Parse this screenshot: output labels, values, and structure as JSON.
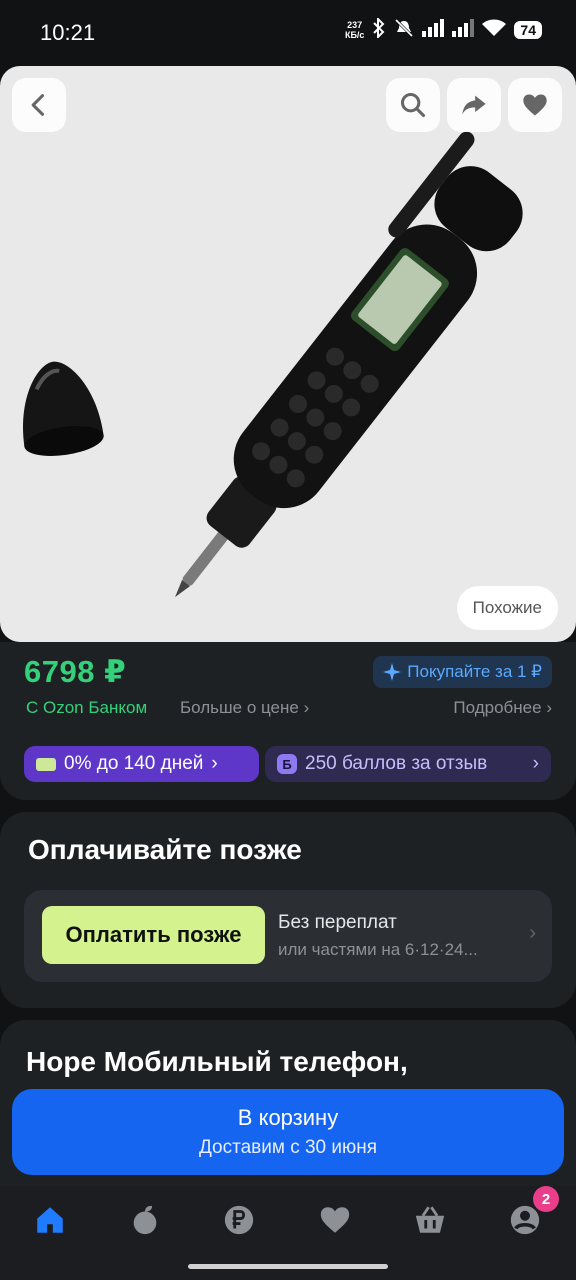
{
  "status_bar": {
    "time": "10:21",
    "net_speed_value": "237",
    "net_speed_unit": "КБ/с",
    "battery": "74",
    "icons": [
      "bluetooth-icon",
      "mute-icon",
      "signal-icon",
      "signal-icon",
      "wifi-icon",
      "battery-icon"
    ]
  },
  "gallery": {
    "back_icon": "chevron-left-icon",
    "search_icon": "search-icon",
    "share_icon": "share-icon",
    "favorite_icon": "heart-icon",
    "similar_label": "Похожие"
  },
  "price": {
    "value": "6798 ₽",
    "ozon_bank": "С Ozon Банком",
    "more_about_price": "Больше о цене",
    "buy_for_1": "Покупайте за 1 ₽",
    "details": "Подробнее",
    "installment": "0% до 140 дней",
    "points": "250 баллов за отзыв",
    "points_badge": "Б"
  },
  "pay_later": {
    "title": "Оплачивайте позже",
    "button": "Оплатить позже",
    "line1": "Без переплат",
    "line2": "или частями на 6·12·24..."
  },
  "product": {
    "title": "Hope Мобильный телефон,"
  },
  "cart": {
    "label": "В корзину",
    "delivery": "Доставим с 30 июня"
  },
  "bottom_nav": {
    "items": [
      "home-icon",
      "fresh-icon",
      "ruble-icon",
      "favorites-icon",
      "cart-icon",
      "profile-icon"
    ],
    "profile_badge": "2",
    "active_color": "#1f7bff"
  },
  "colors": {
    "price_green": "#33d17a",
    "primary_blue": "#1565f0",
    "pay_later_green": "#d4f28e",
    "installment_purple": "#5e37c9"
  }
}
